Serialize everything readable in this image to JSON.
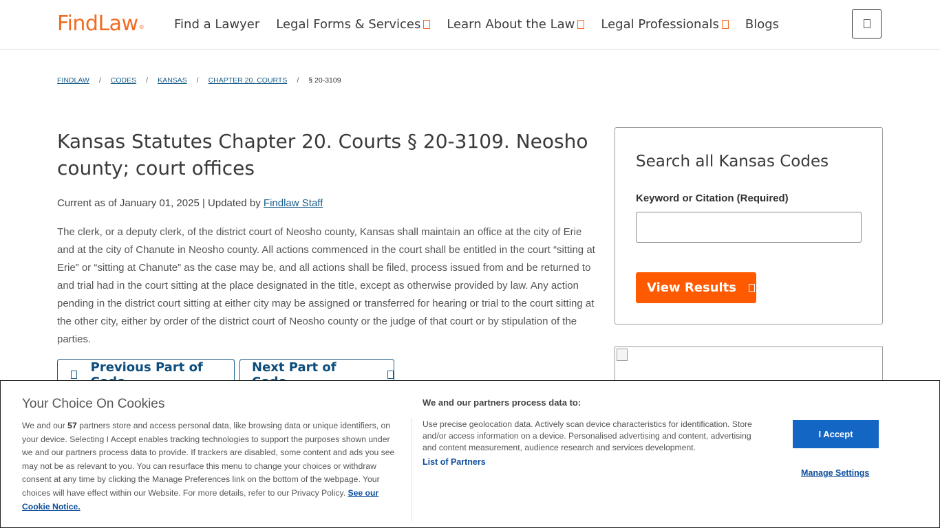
{
  "header": {
    "logo": "FindLaw",
    "logo_mark": "®",
    "nav": [
      {
        "label": "Find a Lawyer",
        "has_menu": false
      },
      {
        "label": "Legal Forms & Services",
        "has_menu": true
      },
      {
        "label": "Learn About the Law",
        "has_menu": true
      },
      {
        "label": "Legal Professionals",
        "has_menu": true
      },
      {
        "label": "Blogs",
        "has_menu": false
      }
    ],
    "menu_icon": "menu-icon"
  },
  "breadcrumb": {
    "items": [
      "FINDLAW",
      "CODES",
      "KANSAS",
      "CHAPTER 20. COURTS"
    ],
    "separator": "/",
    "current": "§ 20-3109"
  },
  "article": {
    "title": "Kansas Statutes Chapter 20. Courts § 20-3109. Neosho county; court offices",
    "meta_prefix": "Current as of January 01, 2025 | Updated by ",
    "meta_author": "Findlaw Staff",
    "body": "The clerk, or a deputy clerk, of the district court of Neosho county, Kansas shall maintain an office at the city of Erie and at the city of Chanute in Neosho county. All actions commenced in the court shall be entitled in the court “sitting at Erie” or “sitting at Chanute” as the case may be, and all actions shall be filed, process issued from and be returned to and trial had in the court sitting at the place designated in the title, except as otherwise provided by law. Any action pending in the district court sitting at either city may be assigned or transferred for hearing or trial to the court sitting at the other city, either by order of the district court of Neosho county or the judge of that court or by stipulation of the parties.",
    "prev_label": "Previous Part of Code",
    "next_label": "Next Part of Code"
  },
  "search": {
    "title": "Search all Kansas Codes",
    "label": "Keyword or Citation (Required)",
    "value": "",
    "button_label": "View Results"
  },
  "cookie": {
    "title": "Your Choice On Cookies",
    "text_before_count": "We and our ",
    "partner_count": "57",
    "text_after_count": " partners store and access personal data, like browsing data or unique identifiers, on your device. Selecting I Accept enables tracking technologies to support the purposes shown under we and our partners process data to provide. If trackers are disabled, some content and ads you see may not be as relevant to you. You can resurface this menu to change your choices or withdraw consent at any time by clicking the Manage Preferences link on the bottom of the webpage. Your choices will have effect within our Website. For more details, refer to our Privacy Policy. ",
    "notice_link": "See our Cookie Notice.",
    "partners_title": "We and our partners process data to:",
    "partners_text": "Use precise geolocation data. Actively scan device characteristics for identification. Store and/or access information on a device. Personalised advertising and content, advertising and content measurement, audience research and services development.",
    "partners_link": "List of Partners",
    "accept_label": "I Accept",
    "manage_label": "Manage Settings"
  },
  "colors": {
    "brand_orange": "#f26a21",
    "button_orange": "#ff5a00",
    "link_blue": "#1a5e8a",
    "accept_blue": "#1466c4"
  }
}
